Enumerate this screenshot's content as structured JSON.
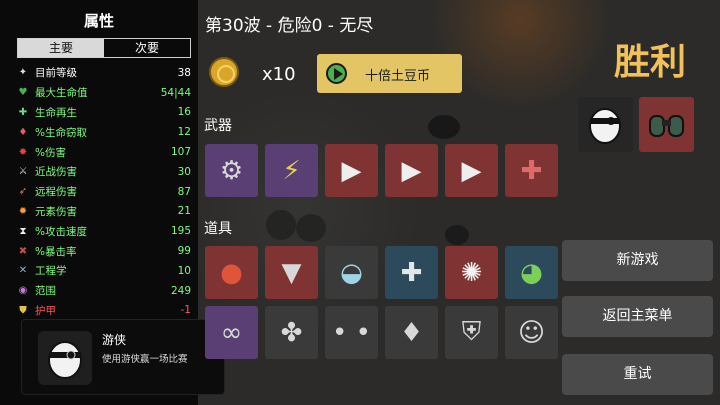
{
  "stats_panel": {
    "title": "属性",
    "tabs": [
      "主要",
      "次要"
    ],
    "stats": [
      {
        "name": "目前等级",
        "value": "38",
        "color": "#ffffff",
        "icon": "level-icon"
      },
      {
        "name": "最大生命值",
        "value": "54|44",
        "color": "#7CFC7C",
        "icon": "heart-icon"
      },
      {
        "name": "生命再生",
        "value": "16",
        "color": "#7CFC7C",
        "icon": "regen-icon"
      },
      {
        "name": "%生命窃取",
        "value": "12",
        "color": "#7CFC7C",
        "icon": "lifesteal-icon"
      },
      {
        "name": "%伤害",
        "value": "107",
        "color": "#7CFC7C",
        "icon": "damage-icon"
      },
      {
        "name": "近战伤害",
        "value": "30",
        "color": "#7CFC7C",
        "icon": "melee-icon"
      },
      {
        "name": "远程伤害",
        "value": "87",
        "color": "#7CFC7C",
        "icon": "ranged-icon"
      },
      {
        "name": "元素伤害",
        "value": "21",
        "color": "#7CFC7C",
        "icon": "elemental-icon"
      },
      {
        "name": "%攻击速度",
        "value": "195",
        "color": "#7CFC7C",
        "icon": "attack-speed-icon"
      },
      {
        "name": "%暴击率",
        "value": "99",
        "color": "#7CFC7C",
        "icon": "crit-icon"
      },
      {
        "name": "工程学",
        "value": "10",
        "color": "#7CFC7C",
        "icon": "engineering-icon"
      },
      {
        "name": "范围",
        "value": "249",
        "color": "#7CFC7C",
        "icon": "range-icon"
      },
      {
        "name": "护甲",
        "value": "-1",
        "color": "#ff5555",
        "icon": "armor-icon"
      }
    ]
  },
  "tooltip": {
    "name": "游侠",
    "description": "使用游侠赢一场比赛"
  },
  "header": {
    "wave_text": "第30波 - 危险0 - 无尽",
    "coin_multiplier": "x10",
    "potato_button": "十倍土豆币"
  },
  "weapons": {
    "label": "武器",
    "items": [
      {
        "icon": "minigun-icon",
        "tier": "purple"
      },
      {
        "icon": "taser-icon",
        "tier": "purple"
      },
      {
        "icon": "laser-gun-icon",
        "tier": "red"
      },
      {
        "icon": "laser-gun-icon",
        "tier": "red"
      },
      {
        "icon": "laser-gun-icon",
        "tier": "red"
      },
      {
        "icon": "revolver-icon",
        "tier": "red"
      }
    ]
  },
  "items": {
    "label": "道具",
    "row1": [
      {
        "icon": "tomato-icon",
        "tier": "red"
      },
      {
        "icon": "wolf-icon",
        "tier": "red"
      },
      {
        "icon": "cauldron-icon",
        "tier": "dark"
      },
      {
        "icon": "medkit-icon",
        "tier": "blue"
      },
      {
        "icon": "spiky-shield-icon",
        "tier": "red"
      },
      {
        "icon": "frog-icon",
        "tier": "blue"
      }
    ],
    "row2": [
      {
        "icon": "chain-icon",
        "tier": "purple"
      },
      {
        "icon": "propeller-hat-icon",
        "tier": "dark"
      },
      {
        "icon": "shadow-eyes-icon",
        "tier": "dark"
      },
      {
        "icon": "potion-icon",
        "tier": "dark"
      },
      {
        "icon": "knight-helmet-icon",
        "tier": "dark"
      },
      {
        "icon": "ghost-icon",
        "tier": "dark"
      }
    ]
  },
  "right_panel": {
    "victory_text": "胜利",
    "character_icon": "egg-character-icon",
    "equipped_icon": "binoculars-icon",
    "buttons": {
      "new_game": "新游戏",
      "main_menu": "返回主菜单",
      "retry": "重试"
    }
  }
}
